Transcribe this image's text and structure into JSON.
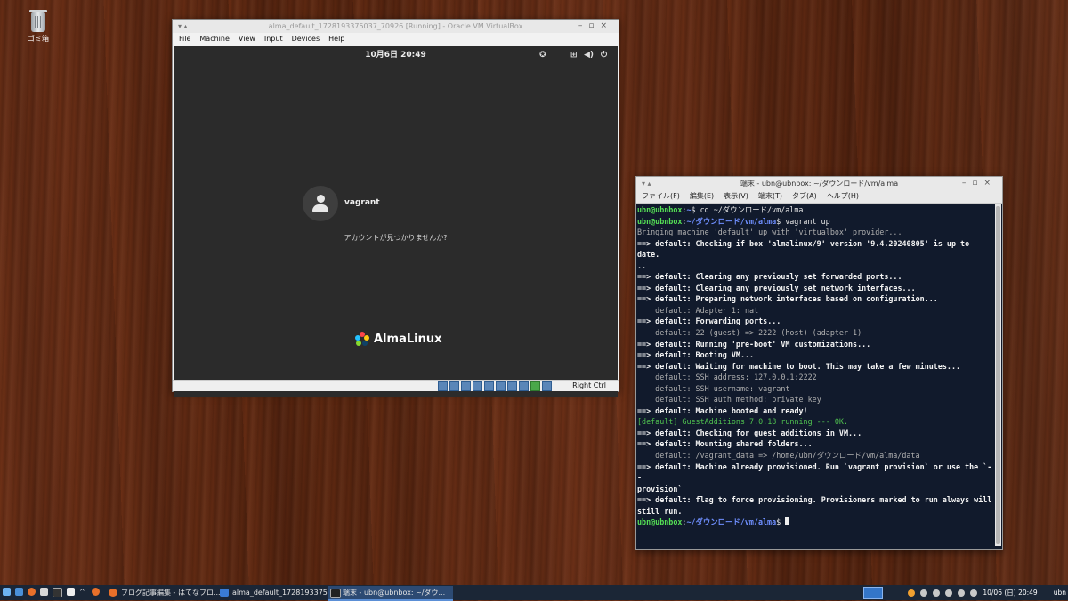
{
  "desktop": {
    "trash_label": "ゴミ箱"
  },
  "vbox": {
    "title": "alma_default_1728193375037_70926 [Running] - Oracle VM VirtualBox",
    "menu": [
      "File",
      "Machine",
      "View",
      "Input",
      "Devices",
      "Help"
    ],
    "status_host_key": "Right Ctrl",
    "guest": {
      "clock": "10月6日  20:49",
      "user": "vagrant",
      "not_listed": "アカウントが見つかりませんか?",
      "logo_text": "AlmaLinux"
    }
  },
  "terminal": {
    "title": "端末 - ubn@ubnbox: ~/ダウンロード/vm/alma",
    "menu": [
      "ファイル(F)",
      "編集(E)",
      "表示(V)",
      "端末(T)",
      "タブ(A)",
      "ヘルプ(H)"
    ],
    "prompt_user": "ubn@ubnbox",
    "lines": {
      "l1_path": "~",
      "l1_cmd": "$ cd ~/ダウンロード/vm/alma",
      "l2_path": "~/ダウンロード/vm/alma",
      "l2_cmd": "$ vagrant up",
      "l3": "Bringing machine 'default' up with 'virtualbox' provider...",
      "l4": "==> default: Checking if box 'almalinux/9' version '9.4.20240805' is up to date.\n..",
      "l5": "==> default: Clearing any previously set forwarded ports...",
      "l6": "==> default: Clearing any previously set network interfaces...",
      "l7": "==> default: Preparing network interfaces based on configuration...",
      "l8": "    default: Adapter 1: nat",
      "l9": "==> default: Forwarding ports...",
      "l10": "    default: 22 (guest) => 2222 (host) (adapter 1)",
      "l11": "==> default: Running 'pre-boot' VM customizations...",
      "l12": "==> default: Booting VM...",
      "l13": "==> default: Waiting for machine to boot. This may take a few minutes...",
      "l14": "    default: SSH address: 127.0.0.1:2222",
      "l15": "    default: SSH username: vagrant",
      "l16": "    default: SSH auth method: private key",
      "l17": "==> default: Machine booted and ready!",
      "l18": "[default] GuestAdditions 7.0.18 running --- OK.",
      "l19": "==> default: Checking for guest additions in VM...",
      "l20": "==> default: Mounting shared folders...",
      "l21": "    default: /vagrant_data => /home/ubn/ダウンロード/vm/alma/data",
      "l22": "==> default: Machine already provisioned. Run `vagrant provision` or use the `--\nprovision`",
      "l23": "==> default: flag to force provisioning. Provisioners marked to run always will\nstill run.",
      "l24_path": "~/ダウンロード/vm/alma",
      "l24_cmd": "$ "
    }
  },
  "taskbar": {
    "tasks": [
      "ブログ記事編集 - はてなブロ...",
      "alma_default_17281933750...",
      "端末 - ubn@ubnbox: ~/ダウ..."
    ],
    "clock": "10/06 (日) 20:49",
    "user": "ubn"
  }
}
